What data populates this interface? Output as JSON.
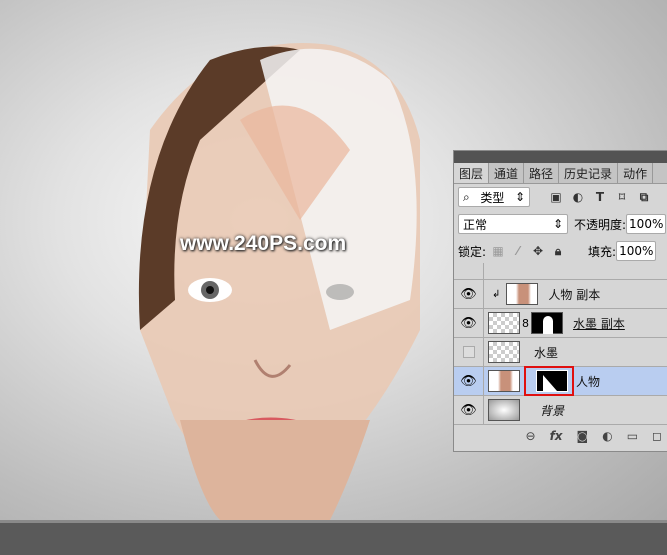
{
  "watermark": "www.240PS.com",
  "panel": {
    "tabs": [
      "图层",
      "通道",
      "路径",
      "历史记录",
      "动作"
    ],
    "filter": {
      "icon": "search-icon",
      "label": "类型"
    },
    "filter_icons": [
      "image-filter-icon",
      "adjustment-filter-icon",
      "type-filter-icon",
      "shape-filter-icon",
      "smart-object-filter-icon"
    ],
    "blend_mode": "正常",
    "opacity_label": "不透明度:",
    "opacity": "100%",
    "lock_label": "锁定:",
    "fill_label": "填充:",
    "fill": "100%",
    "layers": [
      {
        "name": "人物 副本",
        "visible": true,
        "clipped": true
      },
      {
        "name": "水墨 副本",
        "visible": true,
        "mask": true
      },
      {
        "name": "水墨",
        "visible": false
      },
      {
        "name": "人物",
        "visible": true,
        "mask": true,
        "selected": true
      },
      {
        "name": "背景",
        "visible": true
      }
    ],
    "footer_icons": [
      "link-icon",
      "fx-icon",
      "add-mask-icon",
      "adjustment-icon",
      "group-icon",
      "new-layer-icon"
    ],
    "fx_label": "fx"
  },
  "colors": {
    "selection": "#b9cdf0",
    "highlight": "#e01010"
  }
}
